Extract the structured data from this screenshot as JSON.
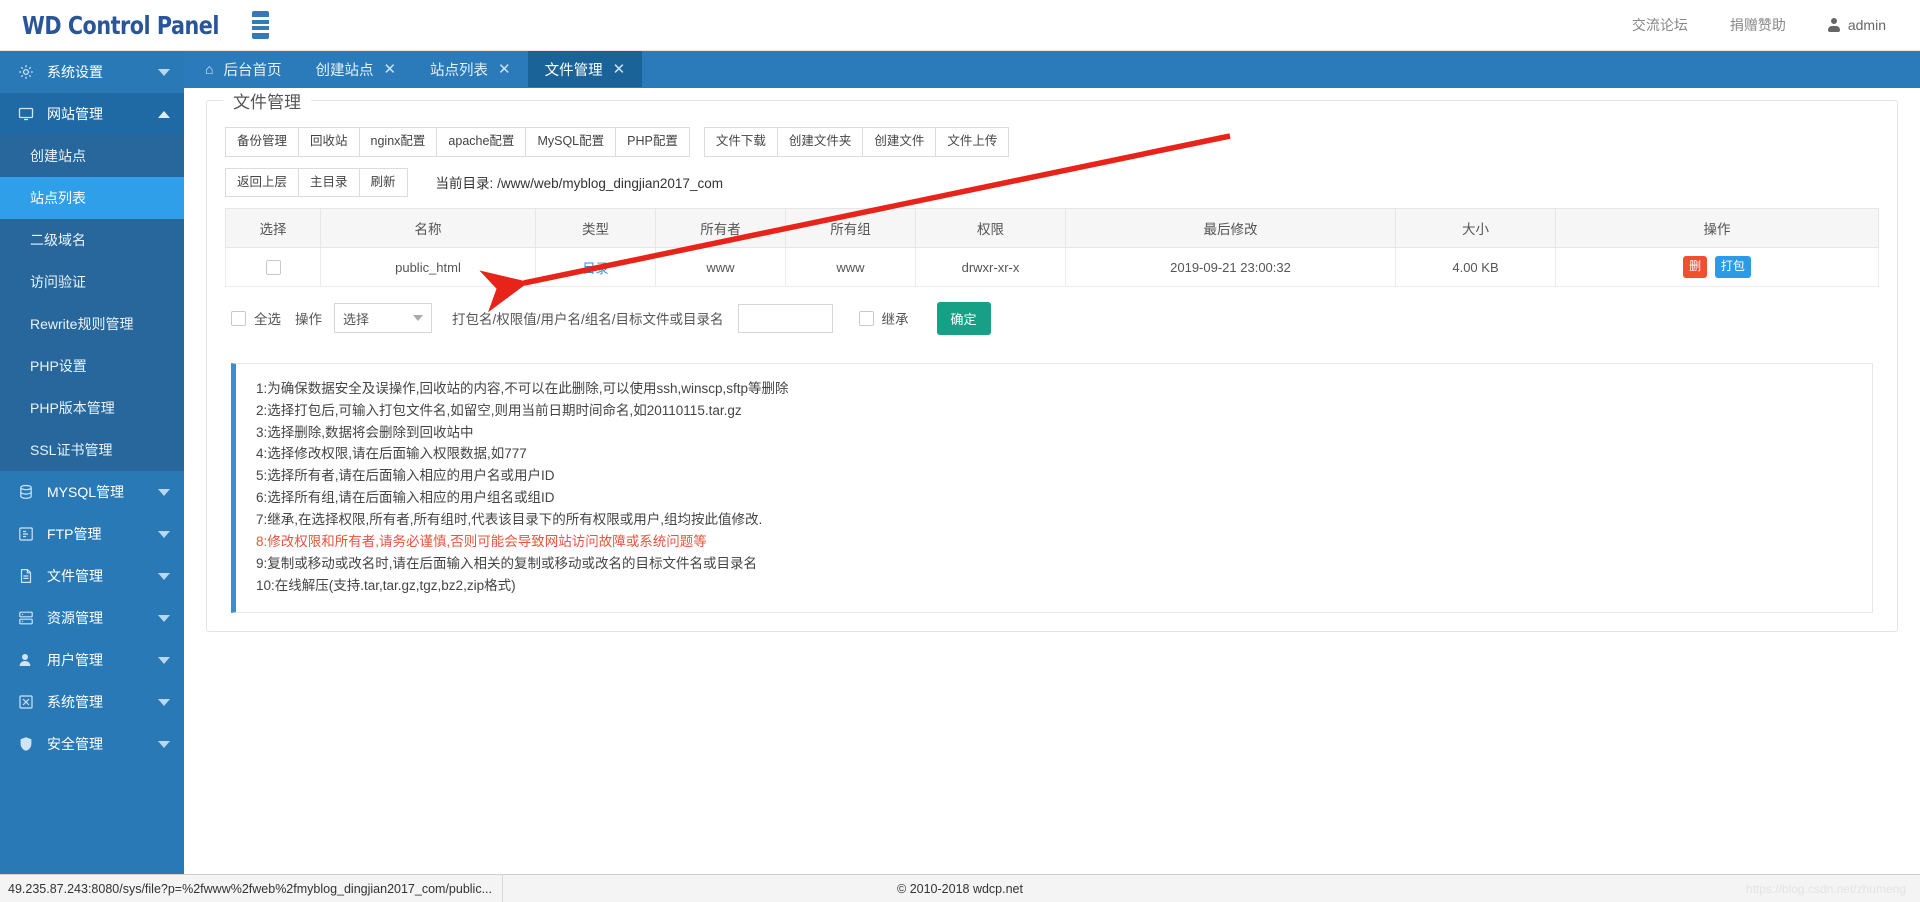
{
  "brand": {
    "title": "WD Control Panel",
    "menu_icon": "hamburger-icon"
  },
  "topnav": {
    "forum": "交流论坛",
    "donate": "捐赠赞助",
    "user": "admin"
  },
  "sidebar": {
    "groups": [
      {
        "label": "系统设置",
        "icon": "gear-icon",
        "expanded": false
      },
      {
        "label": "网站管理",
        "icon": "monitor-icon",
        "expanded": true,
        "children": [
          {
            "label": "创建站点",
            "active": false
          },
          {
            "label": "站点列表",
            "active": true
          },
          {
            "label": "二级域名",
            "active": false
          },
          {
            "label": "访问验证",
            "active": false
          },
          {
            "label": "Rewrite规则管理",
            "active": false
          },
          {
            "label": "PHP设置",
            "active": false
          },
          {
            "label": "PHP版本管理",
            "active": false
          },
          {
            "label": "SSL证书管理",
            "active": false
          }
        ]
      },
      {
        "label": "MYSQL管理",
        "icon": "database-icon",
        "expanded": false
      },
      {
        "label": "FTP管理",
        "icon": "ftp-icon",
        "expanded": false
      },
      {
        "label": "文件管理",
        "icon": "document-icon",
        "expanded": false
      },
      {
        "label": "资源管理",
        "icon": "resource-icon",
        "expanded": false
      },
      {
        "label": "用户管理",
        "icon": "user-icon",
        "expanded": false
      },
      {
        "label": "系统管理",
        "icon": "system-icon",
        "expanded": false
      },
      {
        "label": "安全管理",
        "icon": "shield-icon",
        "expanded": false
      }
    ]
  },
  "tabs": [
    {
      "label": "后台首页",
      "icon": "home-icon",
      "closable": false,
      "active": false
    },
    {
      "label": "创建站点",
      "icon": "",
      "closable": true,
      "active": false
    },
    {
      "label": "站点列表",
      "icon": "",
      "closable": true,
      "active": false
    },
    {
      "label": "文件管理",
      "icon": "",
      "closable": true,
      "active": true
    }
  ],
  "tab_close_glyph": "✕",
  "panel": {
    "legend": "文件管理",
    "toolbar_left": [
      "备份管理",
      "回收站",
      "nginx配置",
      "apache配置",
      "MySQL配置",
      "PHP配置"
    ],
    "toolbar_right": [
      "文件下载",
      "创建文件夹",
      "创建文件",
      "文件上传"
    ],
    "nav_buttons": [
      "返回上层",
      "主目录",
      "刷新"
    ],
    "current_dir_label": "当前目录:",
    "current_dir_value": "/www/web/myblog_dingjian2017_com"
  },
  "table": {
    "headers": [
      "选择",
      "名称",
      "类型",
      "所有者",
      "所有组",
      "权限",
      "最后修改",
      "大小",
      "操作"
    ],
    "rows": [
      {
        "name": "public_html",
        "type": "目录",
        "owner": "www",
        "group": "www",
        "perm": "drwxr-xr-x",
        "modified": "2019-09-21 23:00:32",
        "size": "4.00 KB",
        "actions": [
          {
            "label": "删",
            "style": "delete"
          },
          {
            "label": "打包",
            "style": "pack"
          }
        ]
      }
    ]
  },
  "action_form": {
    "select_all_label": "全选",
    "operation_label": "操作",
    "select_value": "选择",
    "field_hint": "打包名/权限值/用户名/组名/目标文件或目录名",
    "input_value": "",
    "inherit_label": "继承",
    "submit_label": "确定"
  },
  "notice": {
    "lines": [
      {
        "text": "1:为确保数据安全及误操作,回收站的内容,不可以在此删除,可以使用ssh,winscp,sftp等删除",
        "warn": false
      },
      {
        "text": "2:选择打包后,可输入打包文件名,如留空,则用当前日期时间命名,如20110115.tar.gz",
        "warn": false
      },
      {
        "text": "3:选择删除,数据将会删除到回收站中",
        "warn": false
      },
      {
        "text": "4:选择修改权限,请在后面输入权限数据,如777",
        "warn": false
      },
      {
        "text": "5:选择所有者,请在后面输入相应的用户名或用户ID",
        "warn": false
      },
      {
        "text": "6:选择所有组,请在后面输入相应的用户组名或组ID",
        "warn": false
      },
      {
        "text": "7:继承,在选择权限,所有者,所有组时,代表该目录下的所有权限或用户,组均按此值修改.",
        "warn": false
      },
      {
        "text": "8:修改权限和所有者,请务必谨慎,否则可能会导致网站访问故障或系统问题等",
        "warn": true
      },
      {
        "text": "9:复制或移动或改名时,请在后面输入相关的复制或移动或改名的目标文件名或目录名",
        "warn": false
      },
      {
        "text": "10:在线解压(支持.tar,tar.gz,tgz,bz2,zip格式)",
        "warn": false
      }
    ]
  },
  "footer": {
    "status_url": "49.235.87.243:8080/sys/file?p=%2fwww%2fweb%2fmyblog_dingjian2017_com/public...",
    "copyright": "© 2010-2018 wdcp.net",
    "watermark": "https://blog.csdn.net/zhumeng"
  },
  "colors": {
    "brand_blue": "#2a5699",
    "sidebar_blue": "#2979b7",
    "sidebar_active": "#2e9fe8",
    "tabbar_blue": "#2b7ab9",
    "tab_active": "#1a6398",
    "link_blue": "#2b8fd9",
    "delete_red": "#f0502f",
    "pack_blue": "#2b9be8",
    "submit_green": "#16a085",
    "warn_red": "#e8543f",
    "annotation_red": "#e8231a"
  }
}
